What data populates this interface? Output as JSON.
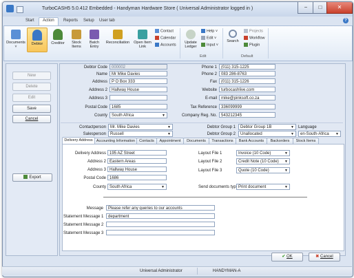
{
  "window": {
    "title": "TurboCASH5 5.0.412  Embedded - Handyman Hardware Store ( Universal Administrator logged in )",
    "minimize": "−",
    "maximize": "□",
    "close": "✕",
    "help": "?"
  },
  "ribbon_tabs": [
    "Start",
    "Action",
    "Reports",
    "Setup",
    "User tab"
  ],
  "ribbon": {
    "large": [
      {
        "label": "Documents",
        "sub": "˅",
        "icon": "documents-icon",
        "color": "#5a8fd6"
      },
      {
        "label": "Debtor",
        "sub": "",
        "icon": "debtor-icon",
        "color": "#3a78c6"
      },
      {
        "label": "Creditor",
        "sub": "",
        "icon": "creditor-icon",
        "color": "#4d8a3a"
      },
      {
        "label": "Stock",
        "sub": "Items",
        "icon": "stock-icon",
        "color": "#c79a3a"
      },
      {
        "label": "Batch",
        "sub": "Entry",
        "icon": "batch-icon",
        "color": "#7a5ab0"
      },
      {
        "label": "Reconciliation",
        "sub": "",
        "icon": "reconciliation-icon",
        "color": "#d0a020"
      },
      {
        "label": "Open Item",
        "sub": "Link",
        "icon": "open-item-icon",
        "color": "#3aa0a0"
      }
    ],
    "small_col1": [
      {
        "label": "Contact",
        "icon": "contact-icon"
      },
      {
        "label": "Calendar",
        "icon": "calendar-icon"
      },
      {
        "label": "Accounts",
        "icon": "accounts-icon"
      }
    ],
    "update": {
      "label": "Update",
      "sub": "Ledger"
    },
    "small_col2": [
      {
        "label": "Help ˅",
        "icon": "help-icon"
      },
      {
        "label": "Edit ˅",
        "icon": "edit-icon"
      },
      {
        "label": "Input ˅",
        "icon": "input-icon"
      }
    ],
    "search": {
      "label": "Search"
    },
    "small_col3": [
      {
        "label": "Projects",
        "icon": "projects-icon"
      },
      {
        "label": "Workflow",
        "icon": "workflow-icon"
      },
      {
        "label": "Plugin",
        "icon": "plugin-icon"
      }
    ],
    "groups": {
      "edit": "Edit",
      "default": "Default"
    }
  },
  "left_buttons": {
    "new": "New",
    "delete": "Delete",
    "edit": "Edit",
    "save": "Save",
    "cancel": "Cancel",
    "export": "Export"
  },
  "debtor": {
    "labels": {
      "code": "Debtor Code",
      "name": "Name",
      "address": "Address",
      "address2": "Address 2",
      "address3": "Address 3",
      "postal": "Postal Code",
      "country": "County",
      "phone1": "Phone 1",
      "phone2": "Phone 2",
      "fax": "Fax",
      "website": "Website",
      "email": "E-mail",
      "tax": "Tax Reference",
      "reg": "Company Reg. No."
    },
    "code": "000002",
    "name": "Mr Mike Davies",
    "address": "P O Box 333",
    "address2": "Hallway House",
    "address3": "",
    "postal": "1685",
    "country": "South Africa",
    "phone1": "(011) 315-1225",
    "phone2": "083 286-8763",
    "fax": "(011) 315-1226",
    "website": "turbocashlive.com",
    "email": "mike@pinksoft.co.za",
    "tax": "336099999",
    "reg": "543212345"
  },
  "contact_row": {
    "contact_label": "Contactperson",
    "contact": "Mr. Mike Davies",
    "sales_label": "Salesperson",
    "sales": "Russell",
    "group1_label": "Debtor Group 1",
    "group1": "Debtor Group 1B",
    "group2_label": "Debtor Group 2",
    "group2": "Unallocated",
    "language_label": "Language",
    "language": "en-South-Africa"
  },
  "tabs": [
    "Delivery Address",
    "Accounting Information",
    "Contacts",
    "Appointment",
    "Documents",
    "Transactions",
    "Bank Accounts",
    "Backorders",
    "Stock Items"
  ],
  "delivery": {
    "labels": {
      "address": "Delivery Address",
      "address2": "Address 2",
      "address3": "Address 3",
      "postal": "Postal Code",
      "country": "County"
    },
    "address": "195 AZ Street",
    "address2": "Eastern Areas",
    "address3": "Hallway House",
    "postal": "1686",
    "country": "South Africa"
  },
  "layout": {
    "file1_label": "Layout File 1",
    "file1": "Invoice (10 Code)",
    "file2_label": "Layout File 2",
    "file2": "Credit Note (10 Code)",
    "file3_label": "Layout File 3",
    "file3": "Quote (10 Code)",
    "send_label": "Send documents type",
    "send": "Print document"
  },
  "messages": {
    "message_label": "Message",
    "message": "Please refer any queries to our accounts",
    "s1_label": "Statement Message 1",
    "s1": "department",
    "s2_label": "Statement Message 2",
    "s2": "",
    "s3_label": "Statement Message 3",
    "s3": ""
  },
  "dialog": {
    "ok": "OK",
    "cancel": "Cancel"
  },
  "status": {
    "user": "Universal Administrator",
    "machine": "HANDYMAN-A"
  }
}
